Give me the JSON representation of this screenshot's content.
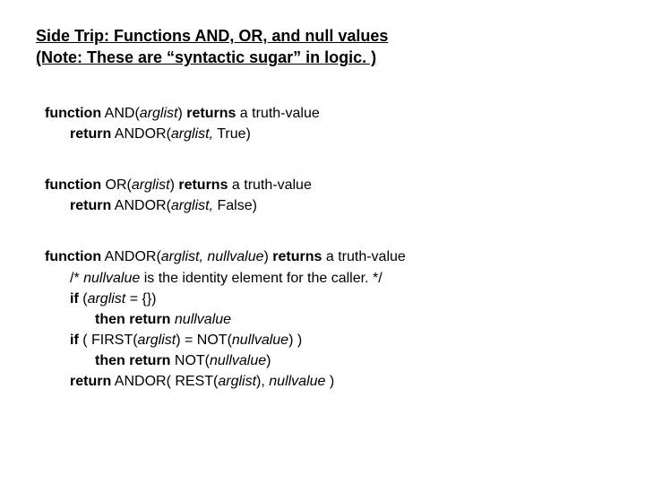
{
  "title_line1": "Side Trip:  Functions AND, OR, and null values",
  "title_line2": "(Note: These are “syntactic sugar” in logic. )",
  "and_block": {
    "sig_fn": "function",
    "sig_name": " AND(",
    "sig_arg": "arglist",
    "sig_ret": ") ",
    "sig_returns": "returns",
    "sig_tail": " a truth-value",
    "body_ret": "return",
    "body_call": " ANDOR(",
    "body_arg": "arglist,",
    "body_tail": " True)"
  },
  "or_block": {
    "sig_fn": "function",
    "sig_name": " OR(",
    "sig_arg": "arglist",
    "sig_ret": ") ",
    "sig_returns": "returns",
    "sig_tail": " a truth-value",
    "body_ret": "return",
    "body_call": " ANDOR(",
    "body_arg": "arglist,",
    "body_tail": " False)"
  },
  "andor_block": {
    "sig_fn": "function",
    "sig_name": " ANDOR(",
    "sig_arg": "arglist, nullvalue",
    "sig_ret": ") ",
    "sig_returns": "returns",
    "sig_tail": " a truth-value",
    "c_open": "/* ",
    "c_var": "nullvalue",
    "c_txt": " is the identity element for the caller. */",
    "if1_if": "if",
    "if1_open": " (",
    "if1_arg": "arglist",
    "if1_tail": " = {})",
    "then1_then": "then return ",
    "then1_val": "nullvalue",
    "if2_if": "if",
    "if2_open": " ( FIRST(",
    "if2_arg": "arglist",
    "if2_mid": ") = NOT(",
    "if2_nv": "nullvalue",
    "if2_close": ") )",
    "then2_then": "then return",
    "then2_txt": " NOT(",
    "then2_nv": "nullvalue",
    "then2_close": ")",
    "ret_kw": "return",
    "ret_txt1": " ANDOR( REST(",
    "ret_arg": "arglist",
    "ret_txt2": "), ",
    "ret_nv": "nullvalue",
    "ret_close": " )"
  }
}
